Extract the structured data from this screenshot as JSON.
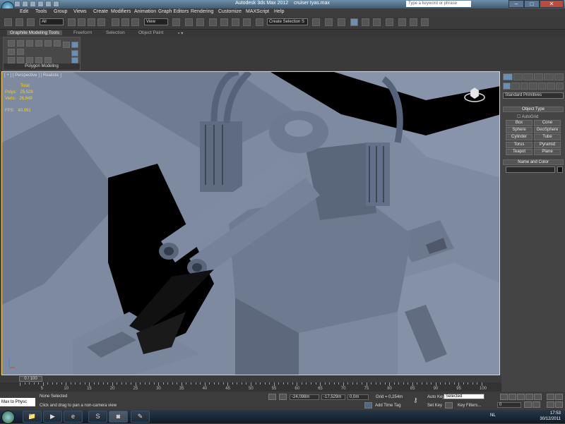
{
  "window": {
    "title_app": "Autodesk 3ds Max  2012",
    "title_file": "cruiser tyas.max",
    "search_placeholder": "Type a keyword or phrase",
    "controls": {
      "minimize": "–",
      "maximize": "□",
      "close": "✕"
    }
  },
  "menu": [
    "Edit",
    "Tools",
    "Group",
    "Views",
    "Create",
    "Modifiers",
    "Animation",
    "Graph Editors",
    "Rendering",
    "Customize",
    "MAXScript",
    "Help"
  ],
  "toolbar": {
    "selection_filter": "All",
    "reference_coord": "View",
    "named_selection": "Create Selection S"
  },
  "ribbon": {
    "tabs": [
      "Graphite Modeling Tools",
      "Freeform",
      "Selection",
      "Object Paint"
    ],
    "panel_label": "Polygon Modeling"
  },
  "viewport": {
    "label": "[ + ] [ Perspective ] [ Realistic ]",
    "stats_header": "Total",
    "polys_label": "Polys:",
    "polys_value": "25,528",
    "verts_label": "Verts:",
    "verts_value": "26,849",
    "fps_label": "FPS:",
    "fps_value": "40.991"
  },
  "command_panel": {
    "dropdown": "Standard Primitives",
    "object_type_title": "Object Type",
    "autogrid_label": "AutoGrid",
    "object_buttons": [
      "Box",
      "Cone",
      "Sphere",
      "GeoSphere",
      "Cylinder",
      "Tube",
      "Torus",
      "Pyramid",
      "Teapot",
      "Plane"
    ],
    "name_color_title": "Name and Color"
  },
  "timeline": {
    "slider_label": "0 / 100",
    "ticks": [
      "5",
      "10",
      "15",
      "20",
      "25",
      "30",
      "35",
      "40",
      "45",
      "50",
      "55",
      "60",
      "65",
      "70",
      "75",
      "80",
      "85",
      "90",
      "95",
      "100"
    ]
  },
  "statusbar": {
    "maxscript_label": "Max to Physc",
    "selection_status": "None Selected",
    "prompt": "Click and drag to pan a non-camera view",
    "x_value": "-24,098m",
    "y_value": "-17,529m",
    "z_value": "0,0m",
    "grid": "Grid = 0,254m",
    "add_time_tag": "Add Time Tag",
    "auto_key": "Auto Key",
    "selected_dropdown": "Selected",
    "set_key": "Set Key",
    "key_filters": "Key Filters...",
    "frame_value": "0"
  },
  "taskbar": {
    "time": "17:53",
    "date": "30/12/2011",
    "language": "NL"
  }
}
